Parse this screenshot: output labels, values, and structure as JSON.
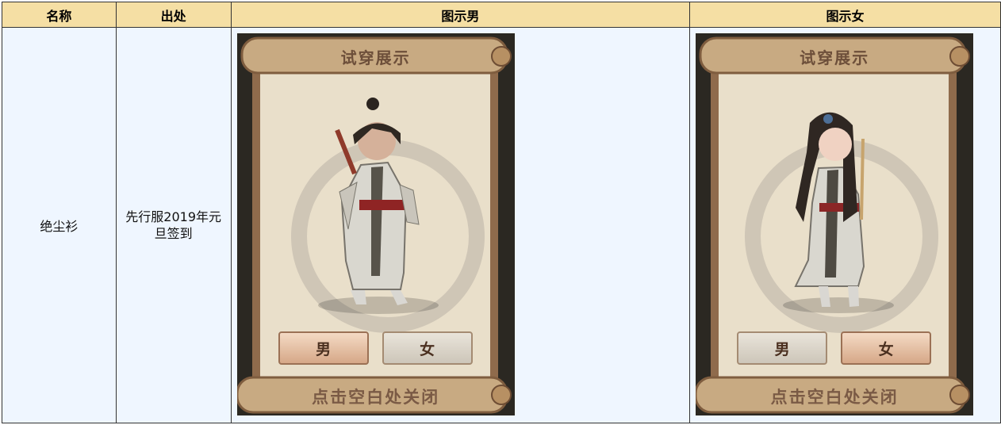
{
  "table": {
    "headers": [
      "名称",
      "出处",
      "图示男",
      "图示女"
    ],
    "row": {
      "name": "绝尘衫",
      "source": "先行服2019年元旦签到"
    }
  },
  "preview": {
    "title": "试穿展示",
    "male_button": "男",
    "female_button": "女",
    "close_hint": "点击空白处关闭"
  },
  "colors": {
    "header_bg": "#f5dfa4",
    "cell_bg": "#eff6ff",
    "scroll_paper": "#ece2cf",
    "selected_button": "#dcae8c"
  }
}
